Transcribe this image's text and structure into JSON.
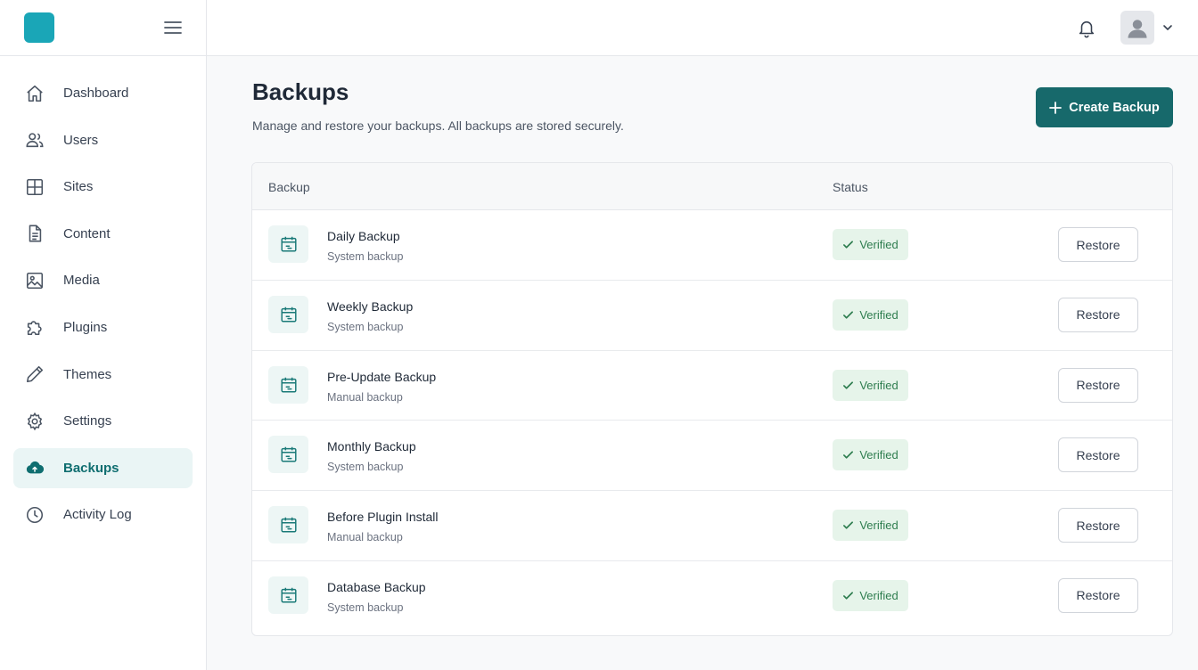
{
  "app": {
    "brand_color": "#1aa6b7",
    "accent_color": "#17696b"
  },
  "sidebar": {
    "items": [
      {
        "label": "Dashboard",
        "icon": "home-icon",
        "active": false
      },
      {
        "label": "Users",
        "icon": "users-icon",
        "active": false
      },
      {
        "label": "Sites",
        "icon": "grid-icon",
        "active": false
      },
      {
        "label": "Content",
        "icon": "document-icon",
        "active": false
      },
      {
        "label": "Media",
        "icon": "image-icon",
        "active": false
      },
      {
        "label": "Plugins",
        "icon": "puzzle-icon",
        "active": false
      },
      {
        "label": "Themes",
        "icon": "brush-icon",
        "active": false
      },
      {
        "label": "Settings",
        "icon": "gear-icon",
        "active": false
      },
      {
        "label": "Backups",
        "icon": "cloud-icon",
        "active": true
      },
      {
        "label": "Activity Log",
        "icon": "clock-icon",
        "active": false
      }
    ]
  },
  "header": {
    "title": "Backups",
    "subtitle": "Manage and restore your backups. All backups are stored securely.",
    "create_label": "Create Backup"
  },
  "table": {
    "columns": [
      "Backup",
      "Status"
    ],
    "rows": [
      {
        "name": "Daily Backup",
        "type": "System backup",
        "status": "Verified",
        "action": "Restore"
      },
      {
        "name": "Weekly Backup",
        "type": "System backup",
        "status": "Verified",
        "action": "Restore"
      },
      {
        "name": "Pre-Update Backup",
        "type": "Manual backup",
        "status": "Verified",
        "action": "Restore"
      },
      {
        "name": "Monthly Backup",
        "type": "System backup",
        "status": "Verified",
        "action": "Restore"
      },
      {
        "name": "Before Plugin Install",
        "type": "Manual backup",
        "status": "Verified",
        "action": "Restore"
      },
      {
        "name": "Database Backup",
        "type": "System backup",
        "status": "Verified",
        "action": "Restore"
      }
    ]
  }
}
